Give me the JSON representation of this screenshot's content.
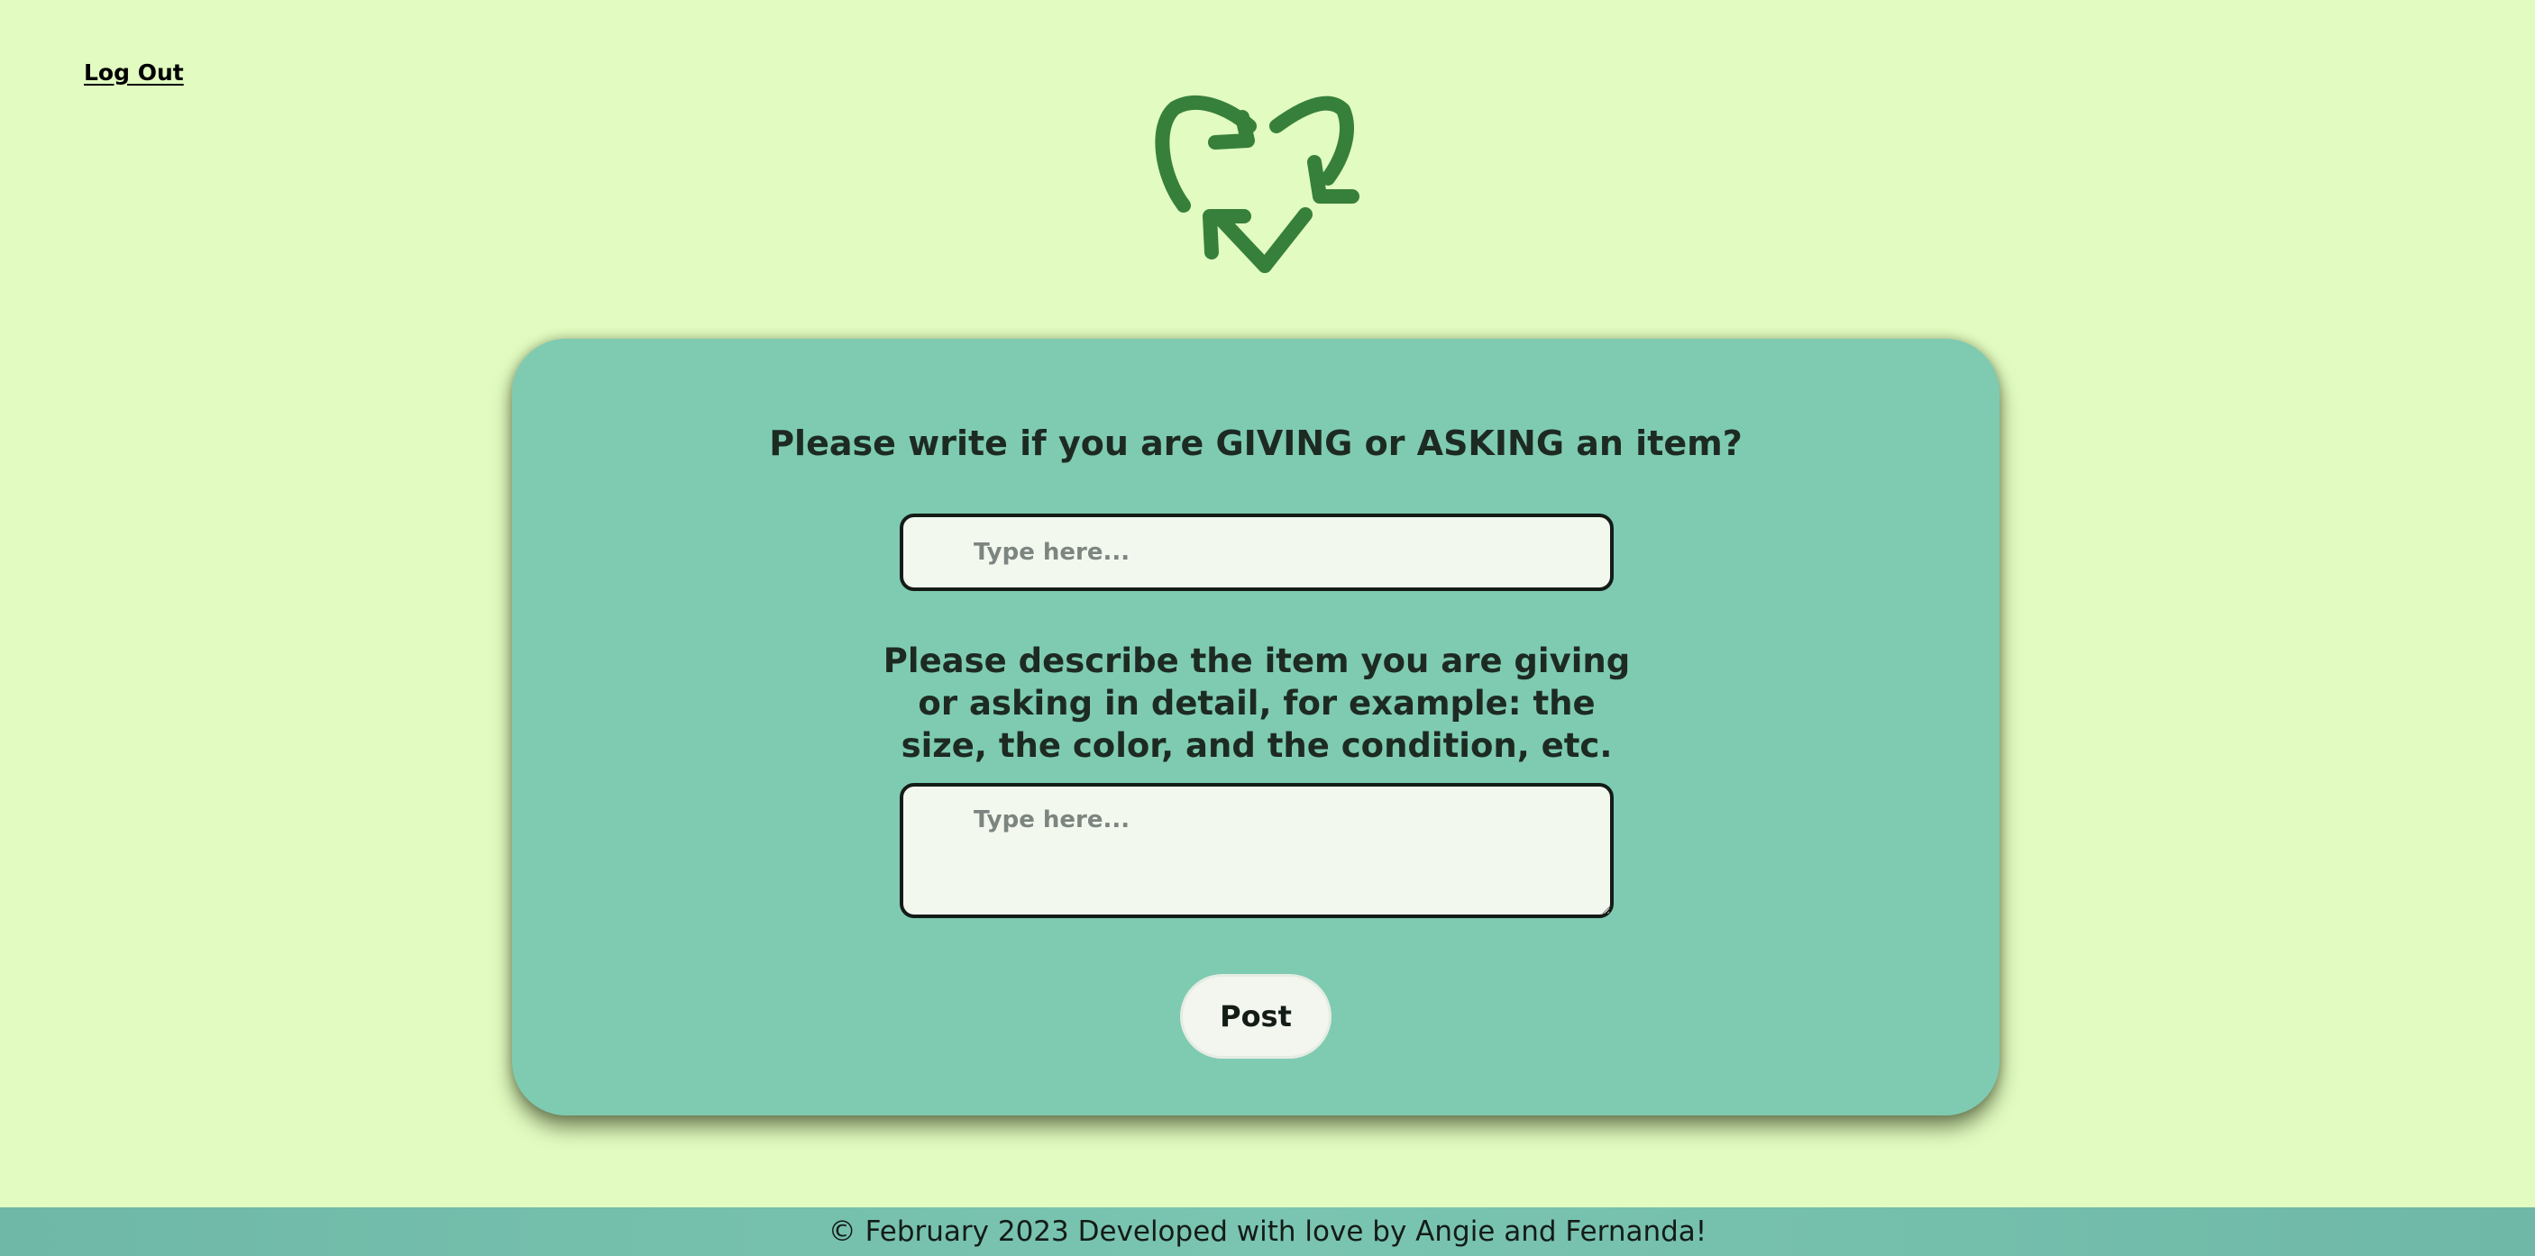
{
  "nav": {
    "logout_label": "Log Out"
  },
  "logo": {
    "icon": "recycle-icon",
    "color": "#37803c"
  },
  "form": {
    "type_question": "Please write if you are GIVING or ASKING an item?",
    "type_placeholder": "Type here...",
    "type_value": "",
    "description_question": "Please describe the item you are giving or asking in detail, for example: the size, the color, and the condition, etc.",
    "description_placeholder": "Type here...",
    "description_value": "",
    "submit_label": "Post"
  },
  "footer": {
    "text": "© February 2023 Developed with love by Angie and Fernanda!"
  },
  "colors": {
    "background": "#e1fbc0",
    "card": "#7ecbb2",
    "footer": "#74bfae",
    "input_background": "#f3f8ef"
  }
}
